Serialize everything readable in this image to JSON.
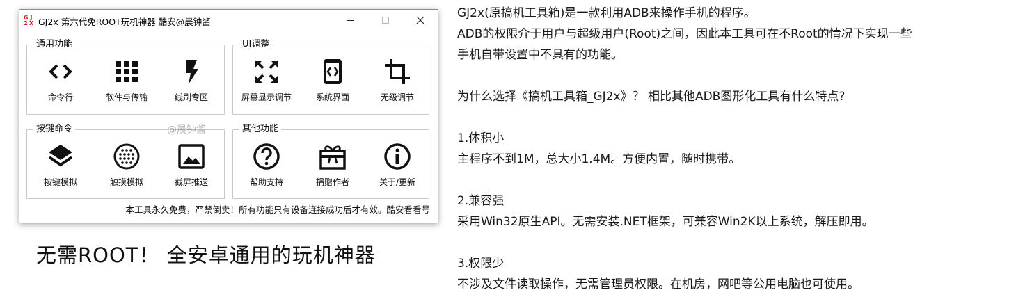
{
  "window": {
    "logo_chars": [
      "G",
      "J",
      "2",
      "X"
    ],
    "title": "GJ2x 第六代免ROOT玩机神器  酷安@晨钟酱",
    "controls": [
      "minimize-icon",
      "maximize-icon",
      "close-icon"
    ]
  },
  "groups": {
    "common": {
      "title": "通用功能",
      "items": [
        {
          "label": "命令行",
          "icon": "code-brackets-icon"
        },
        {
          "label": "软件与传输",
          "icon": "apps-grid-icon"
        },
        {
          "label": "线刷专区",
          "icon": "lightning-icon"
        }
      ]
    },
    "ui": {
      "title": "UI调整",
      "items": [
        {
          "label": "屏幕显示调节",
          "icon": "fullscreen-icon"
        },
        {
          "label": "系统界面",
          "icon": "phone-code-icon"
        },
        {
          "label": "无级调节",
          "icon": "crop-icon"
        }
      ]
    },
    "keys": {
      "title": "按键命令",
      "items": [
        {
          "label": "按键模拟",
          "icon": "layers-icon"
        },
        {
          "label": "触摸模拟",
          "icon": "touch-dots-icon"
        },
        {
          "label": "截屏推送",
          "icon": "image-icon"
        }
      ]
    },
    "other": {
      "title": "其他功能",
      "items": [
        {
          "label": "帮助支持",
          "icon": "help-icon"
        },
        {
          "label": "捐赠作者",
          "icon": "gift-icon"
        },
        {
          "label": "关于/更新",
          "icon": "info-icon"
        }
      ]
    }
  },
  "watermark": "@晨钟酱",
  "notice": "本工具永久免费，严禁倒卖！所有功能只有设备连接成功后才有效。酷安看看号",
  "slogan": "无需ROOT！  全安卓通用的玩机神器",
  "description": {
    "intro": [
      "GJ2x(原搞机工具箱)是一款利用ADB来操作手机的程序。",
      "ADB的权限介于用户与超级用户(Root)之间，因此本工具可在不Root的情况下实现一些",
      "手机自带设置中不具有的功能。"
    ],
    "question": "为什么选择《搞机工具箱_GJ2x》？ 相比其他ADB图形化工具有什么特点?",
    "features": [
      {
        "heading": "1.体积小",
        "text": "主程序不到1M，总大小1.4M。方便内置，随时携带。"
      },
      {
        "heading": "2.兼容强",
        "text": "采用Win32原生API。无需安装.NET框架，可兼容Win2K以上系统，解压即用。"
      },
      {
        "heading": "3.权限少",
        "text": "不涉及文件读取操作，无需管理员权限。在机房，网吧等公用电脑也可使用。"
      }
    ]
  },
  "colors": {
    "logo": "#d02020",
    "text": "#111111",
    "border": "#c8c8c8"
  }
}
